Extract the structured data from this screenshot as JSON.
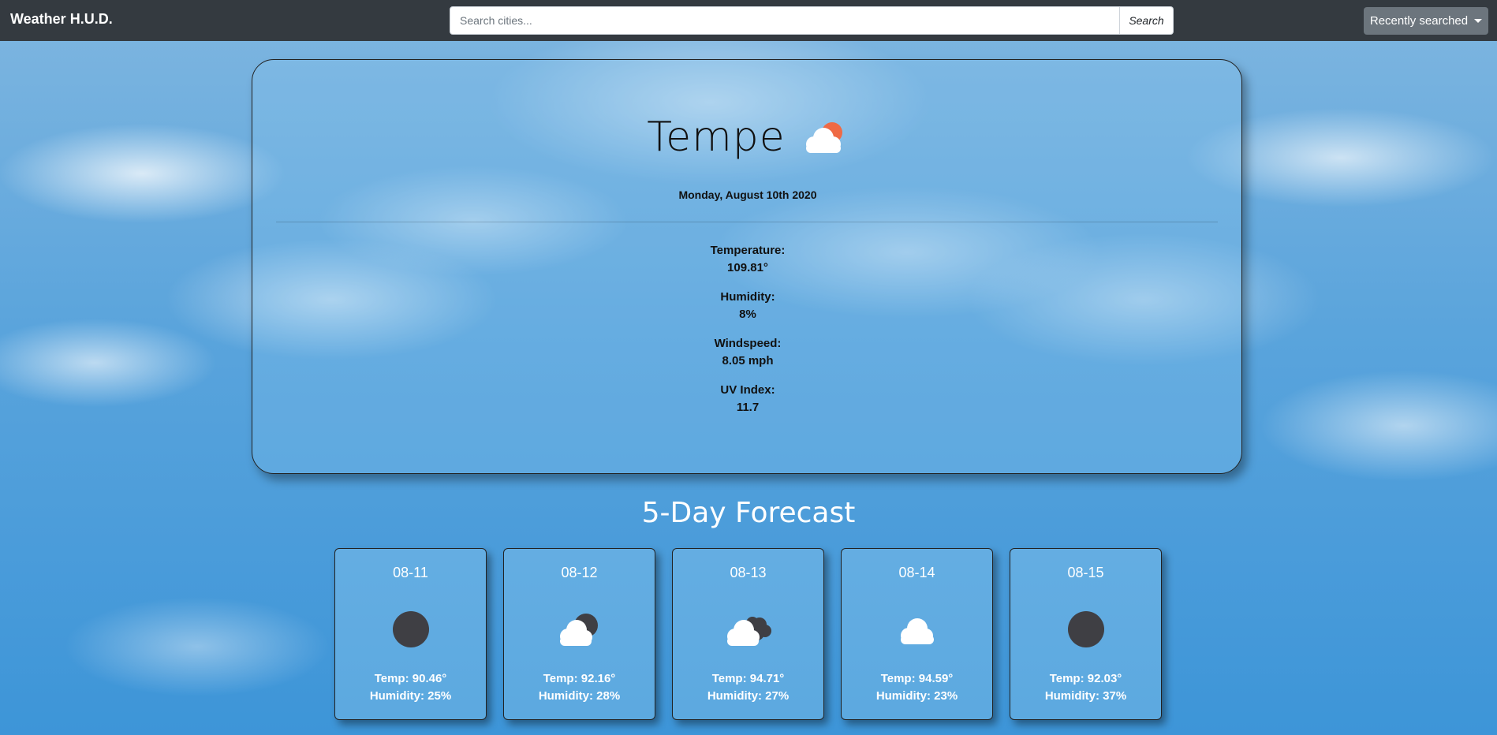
{
  "navbar": {
    "brand": "Weather H.U.D.",
    "search_placeholder": "Search cities...",
    "search_button": "Search",
    "recent_button": "Recently searched"
  },
  "current": {
    "city": "Tempe",
    "icon": "partly-cloudy-sun-icon",
    "date": "Monday, August 10th 2020",
    "temperature_label": "Temperature:",
    "temperature": "109.81°",
    "humidity_label": "Humidity:",
    "humidity": "8%",
    "windspeed_label": "Windspeed:",
    "windspeed": "8.05 mph",
    "uv_label": "UV Index:",
    "uv": "11.7"
  },
  "forecast": {
    "title": "5-Day Forecast",
    "days": [
      {
        "date": "08-11",
        "icon": "moon-icon",
        "temp": "Temp: 90.46°",
        "humidity": "Humidity: 25%"
      },
      {
        "date": "08-12",
        "icon": "cloud-moon-icon",
        "temp": "Temp: 92.16°",
        "humidity": "Humidity: 28%"
      },
      {
        "date": "08-13",
        "icon": "cloud-dark-clouds-icon",
        "temp": "Temp: 94.71°",
        "humidity": "Humidity: 27%"
      },
      {
        "date": "08-14",
        "icon": "cloud-icon",
        "temp": "Temp: 94.59°",
        "humidity": "Humidity: 23%"
      },
      {
        "date": "08-15",
        "icon": "moon-icon",
        "temp": "Temp: 92.03°",
        "humidity": "Humidity: 37%"
      }
    ]
  },
  "colors": {
    "navbar": "#343a40",
    "recent_button": "#6c757d",
    "sun": "#ef6a45",
    "moon": "#3f3f44"
  }
}
